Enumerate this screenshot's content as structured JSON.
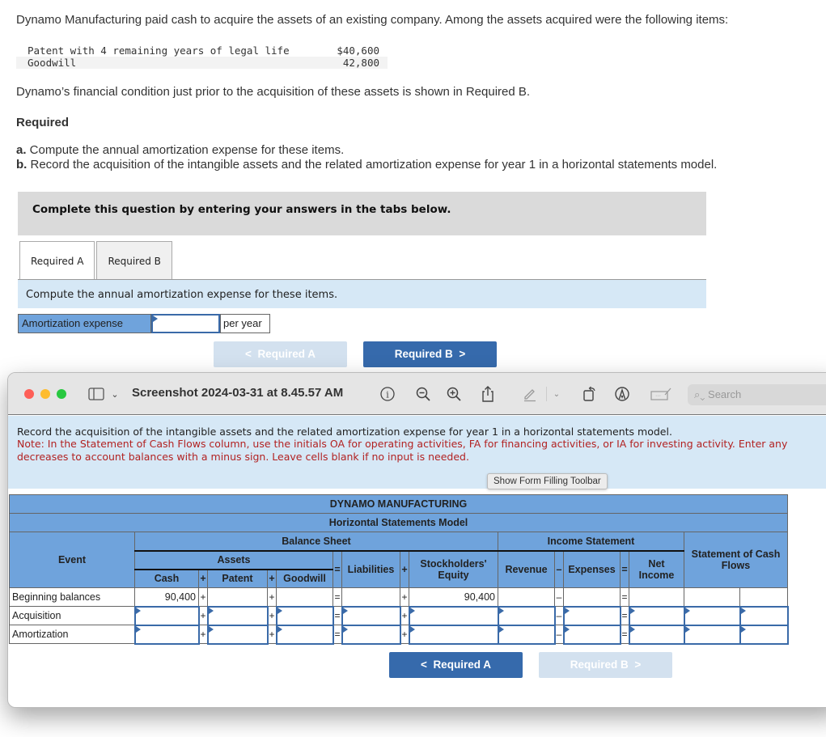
{
  "question": {
    "intro": "Dynamo Manufacturing paid cash to acquire the assets of an existing company. Among the assets acquired were the following items:",
    "assets": [
      {
        "name": "Patent with 4 remaining years of legal life",
        "value": "$40,600"
      },
      {
        "name": "Goodwill",
        "value": "42,800"
      }
    ],
    "condition": "Dynamo’s financial condition just prior to the acquisition of these assets is shown in Required B.",
    "required_heading": "Required",
    "requirements": [
      {
        "letter": "a.",
        "text": " Compute the annual amortization expense for these items."
      },
      {
        "letter": "b.",
        "text": " Record the acquisition of the intangible assets and the related amortization expense for year 1 in a horizontal statements model."
      }
    ],
    "complete_prompt": "Complete this question by entering your answers in the tabs below."
  },
  "tabs": [
    {
      "label": "Required A",
      "active": true
    },
    {
      "label": "Required B",
      "active": false
    }
  ],
  "required_a": {
    "instruction": "Compute the annual amortization expense for these items.",
    "field_label": "Amortization expense",
    "field_value": "",
    "suffix": "per year",
    "prev_label": "Required A",
    "next_label": "Required B"
  },
  "window": {
    "title": "Screenshot 2024-03-31 at 8.45.57 AM",
    "search_placeholder": "Search",
    "traffic_colors": {
      "close": "#fe5f57",
      "minimize": "#febc2e",
      "zoom": "#28c840"
    }
  },
  "required_b": {
    "instruction": "Record the acquisition of the intangible assets and the related amortization expense for year 1 in a horizontal statements model.",
    "note": "Note: In the Statement of Cash Flows column, use the initials OA for operating activities, FA for financing activities, or IA for investing activity. Enter any decreases to account balances with a minus sign. Leave cells blank if no input is needed.",
    "form_toolbar_button": "Show Form Filling Toolbar",
    "table": {
      "company": "DYNAMO MANUFACTURING",
      "model": "Horizontal Statements Model",
      "balance_sheet": "Balance Sheet",
      "income_statement": "Income Statement",
      "cash_flows": "Statement of Cash Flows",
      "event": "Event",
      "assets": "Assets",
      "cash": "Cash",
      "patent": "Patent",
      "goodwill": "Goodwill",
      "liabilities": "Liabilities",
      "equity": "Stockholders' Equity",
      "revenue": "Revenue",
      "expenses": "Expenses",
      "net_income": "Net Income",
      "ops": {
        "plus": "+",
        "eq": "=",
        "minus": "–"
      },
      "rows": [
        {
          "event": "Beginning balances",
          "cash": "90,400",
          "equity": "90,400"
        },
        {
          "event": "Acquisition"
        },
        {
          "event": "Amortization"
        }
      ]
    },
    "prev_label": "Required A",
    "next_label": "Required B"
  },
  "colors": {
    "accent": "#366aac",
    "header_blue": "#6fa3dc",
    "note_red": "#b22222",
    "instr_bg": "#d6e8f6"
  }
}
